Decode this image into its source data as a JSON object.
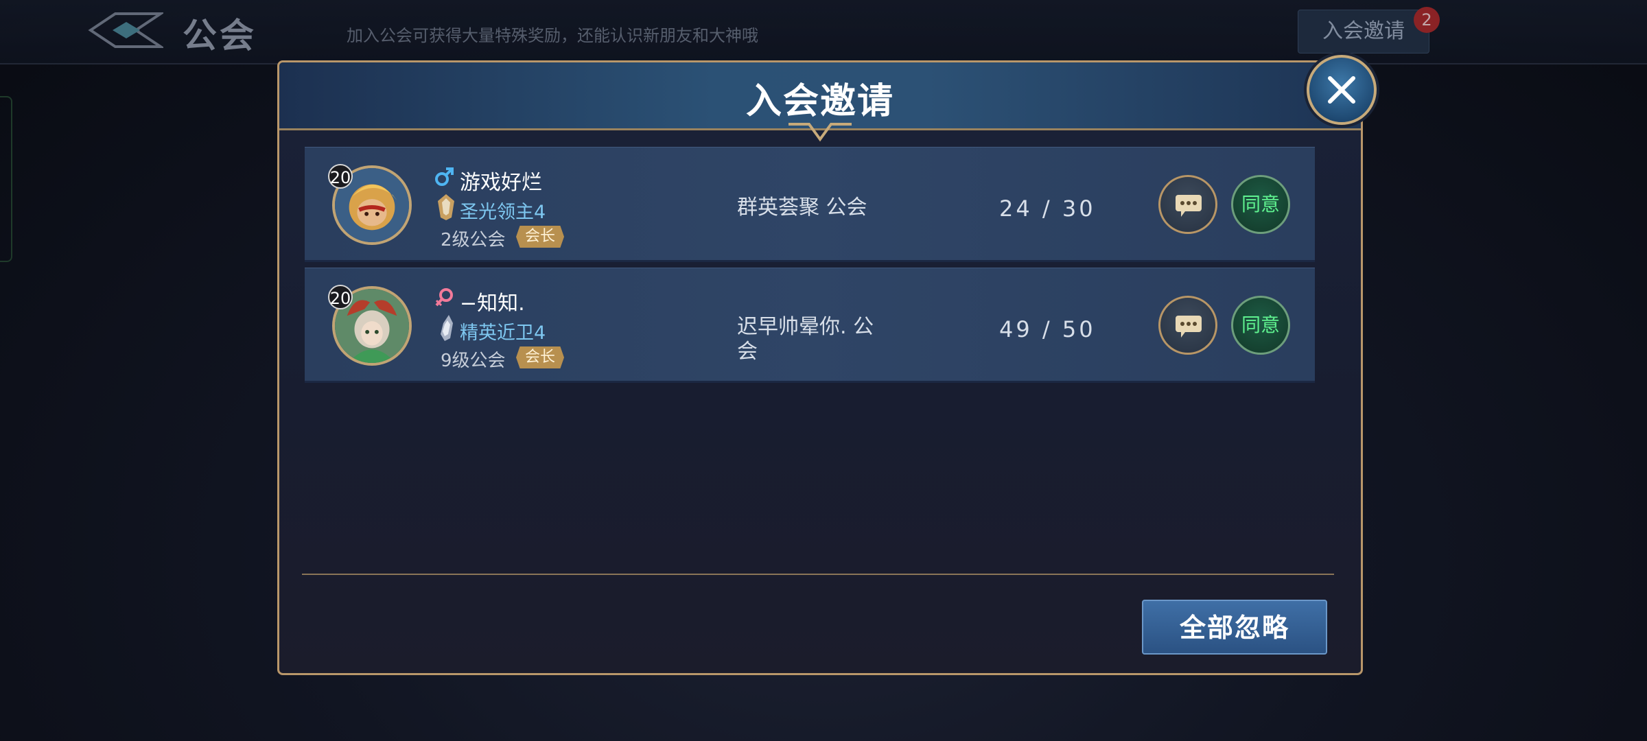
{
  "topbar": {
    "title": "公会",
    "subtitle": "加入公会可获得大量特殊奖励，还能认识新朋友和大神哦",
    "invite_button": "入会邀请",
    "invite_badge": "2"
  },
  "dialog": {
    "title": "入会邀请",
    "ignore_all_button": "全部忽略",
    "invitations": [
      {
        "level": "20",
        "gender": "male",
        "player_name": "游戏好烂",
        "rank": "圣光领主4",
        "guild_level": "2级公会",
        "role": "会长",
        "guild_name": "群英荟聚 公会",
        "members": "24 / 30",
        "agree_label": "同意"
      },
      {
        "level": "20",
        "gender": "female",
        "player_name": "−知知.",
        "rank": "精英近卫4",
        "guild_level": "9级公会",
        "role": "会长",
        "guild_name": "迟早帅晕你. 公会",
        "members": "49 / 50",
        "agree_label": "同意"
      }
    ]
  },
  "colors": {
    "accent_gold": "#b9976a",
    "rank_blue": "#7ec7f0",
    "agree_green": "#5ff28f"
  }
}
